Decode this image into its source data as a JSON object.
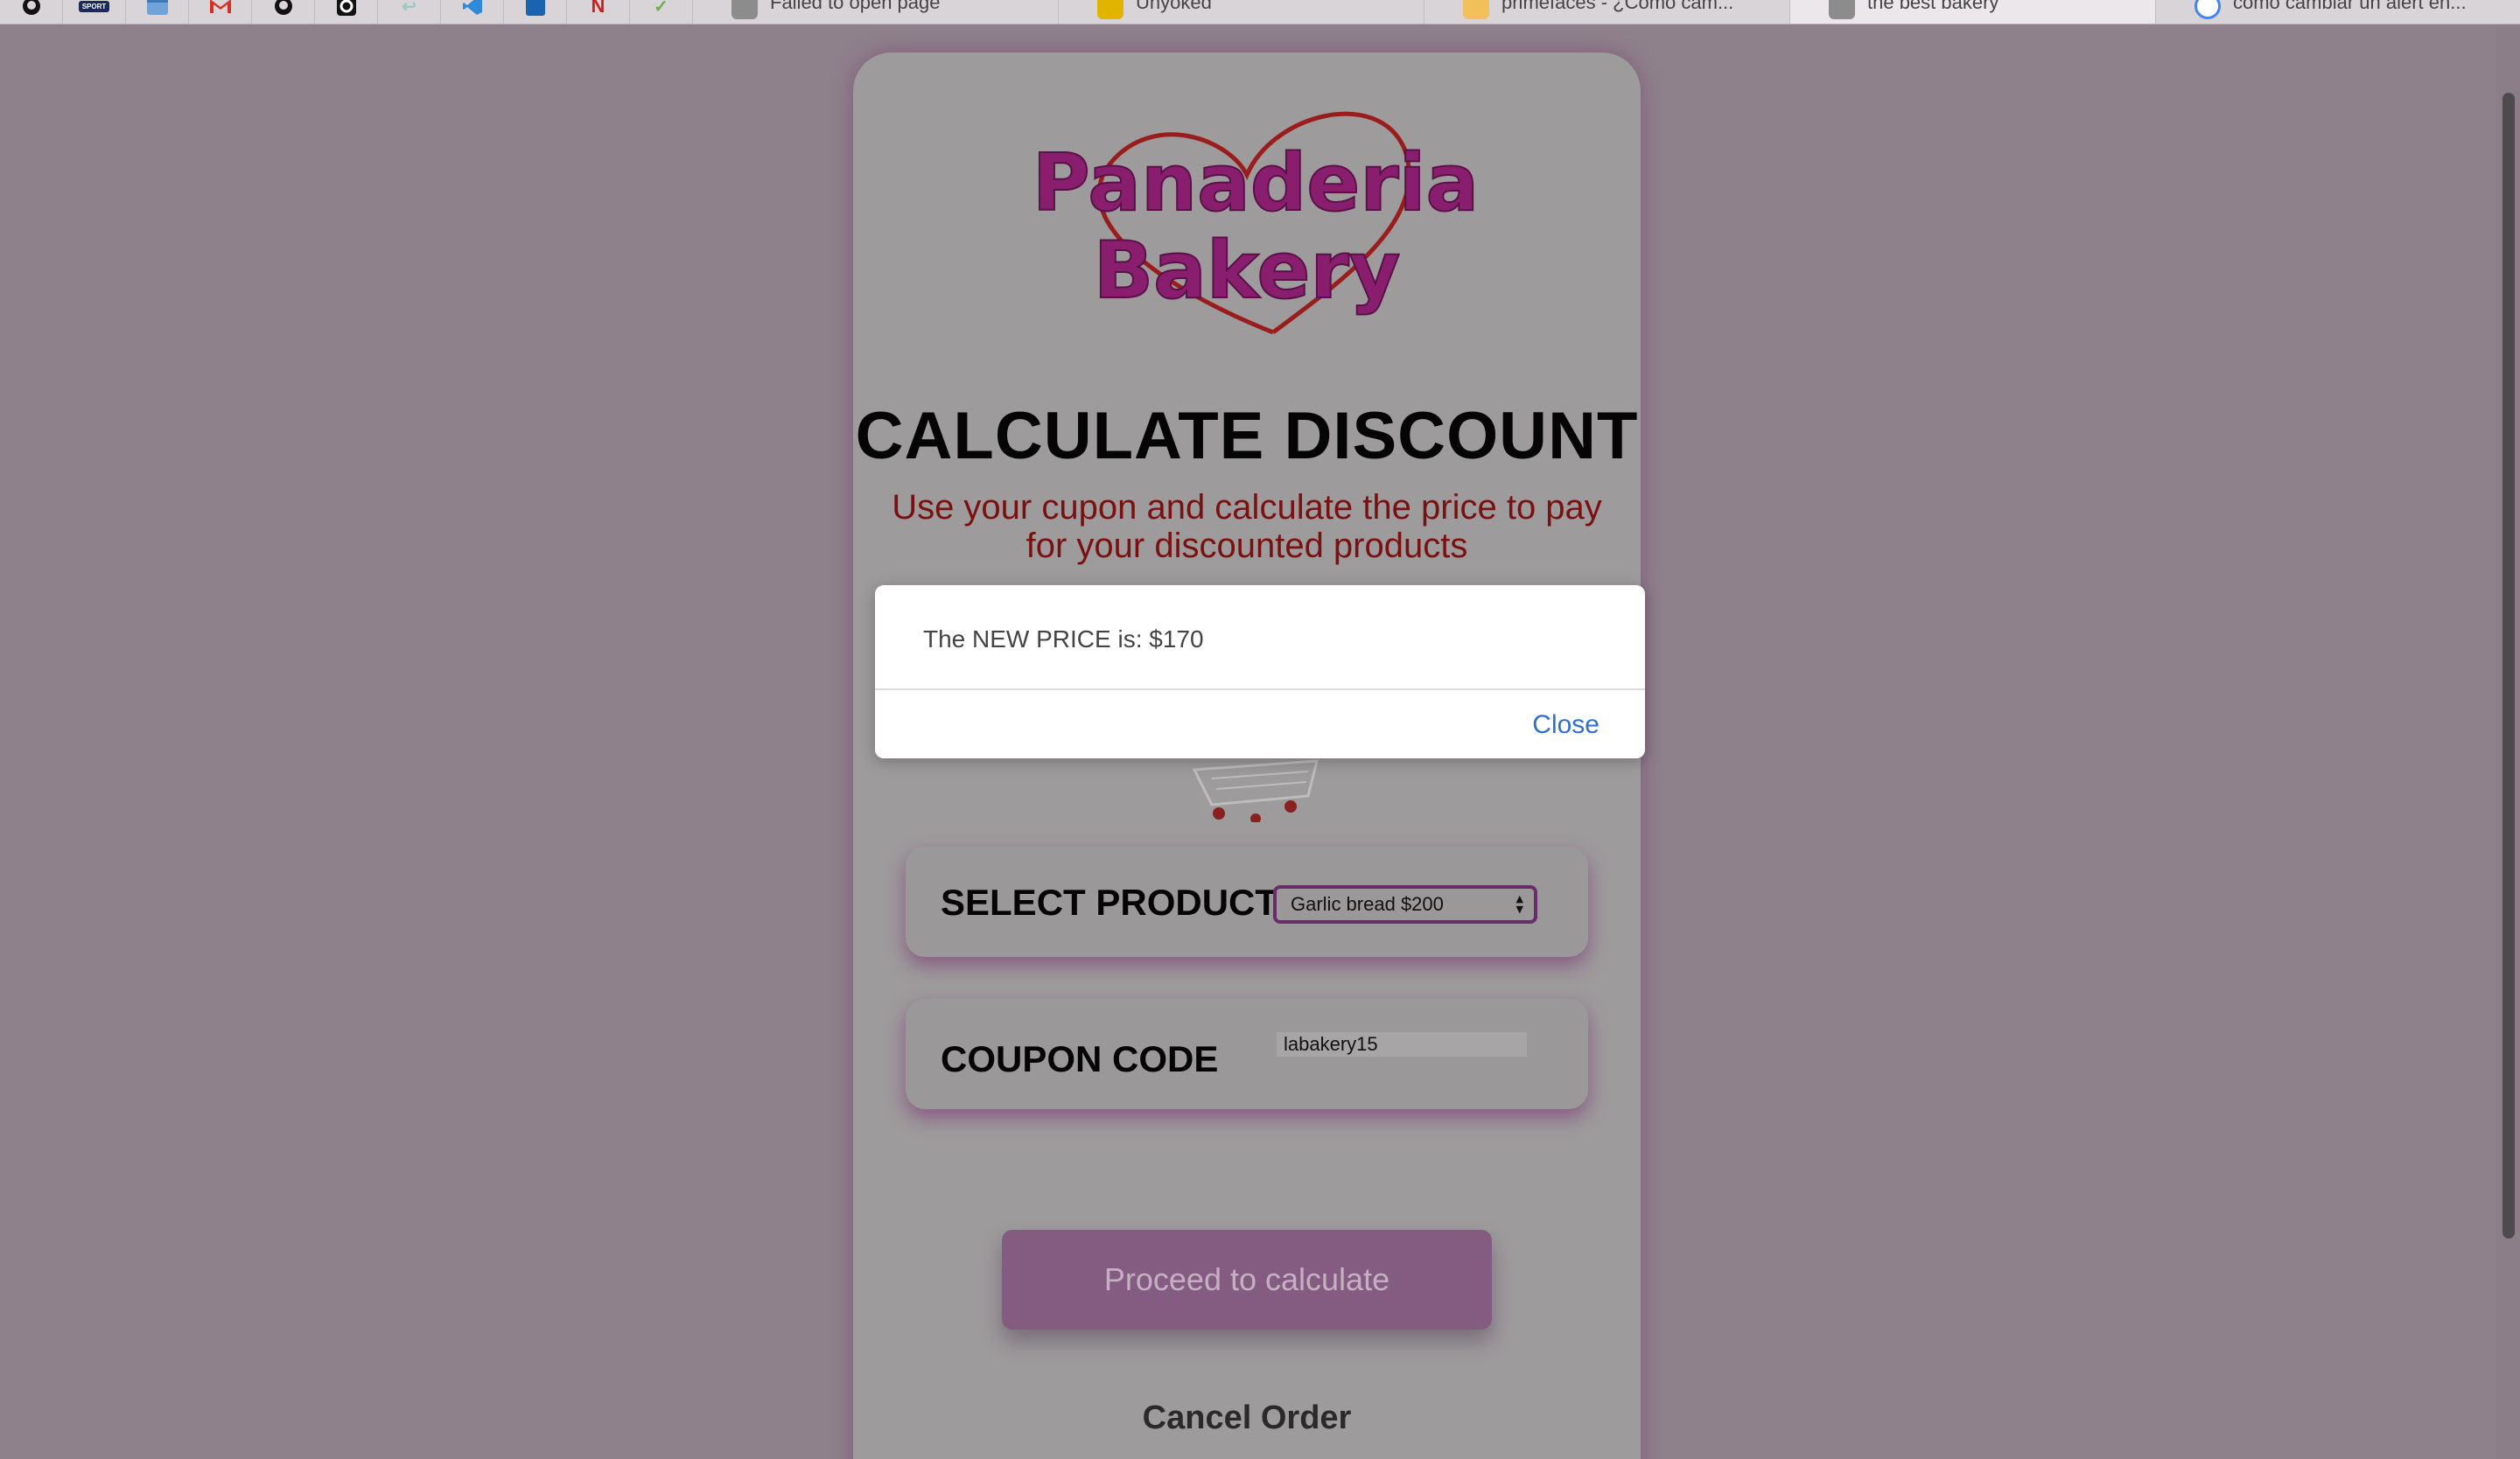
{
  "browser": {
    "bookmarks": [
      {
        "name": "github-icon"
      },
      {
        "name": "sport-icon",
        "text": "SPORT"
      },
      {
        "name": "calendar-icon"
      },
      {
        "name": "gmail-icon"
      },
      {
        "name": "github-icon"
      },
      {
        "name": "c-app-icon"
      },
      {
        "name": "back-arrow-icon"
      },
      {
        "name": "vscode-icon"
      },
      {
        "name": "linkedin-icon"
      },
      {
        "name": "netflix-icon"
      },
      {
        "name": "leaf-icon"
      }
    ],
    "tabs": [
      {
        "title": "Failed to open page",
        "favicon": "page-icon"
      },
      {
        "title": "Unyoked",
        "favicon": "yellow-logo-icon"
      },
      {
        "title": "primefaces - ¿Cómo cam...",
        "favicon": "stackoverflow-icon"
      },
      {
        "title": "the best bakery",
        "favicon": "page-icon",
        "active": true
      },
      {
        "title": "como cambiar un alert en...",
        "favicon": "google-icon"
      }
    ]
  },
  "page": {
    "logo_text": [
      "Panaderia",
      "Bakery"
    ],
    "heading": "CALCULATE DISCOUNT",
    "subheading": "Use your cupon and calculate the price to pay for your discounted products",
    "select_product_label": "SELECT PRODUCT",
    "selected_product": "Garlic bread $200",
    "coupon_label": "COUPON CODE",
    "coupon_value": "labakery15",
    "calculate_button": "Proceed to calculate",
    "cancel_label": "Cancel Order"
  },
  "dialog": {
    "message": "The NEW PRICE is: $170",
    "close_label": "Close"
  },
  "colors": {
    "page_bg": "#8e818b",
    "card_bg": "#9d9b9c",
    "subheading": "#7a1010",
    "button_bg": "#845c81",
    "link_blue": "#2f6fd0"
  }
}
